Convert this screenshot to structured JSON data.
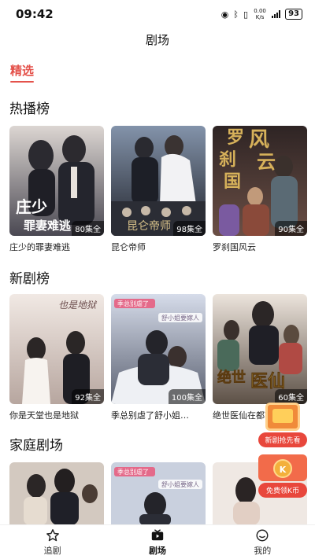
{
  "status_bar": {
    "time": "09:42",
    "network_speed": "0.00 K/s",
    "battery": "93"
  },
  "header": {
    "title": "剧场"
  },
  "top_tabs": [
    {
      "label": "精选",
      "active": true
    }
  ],
  "sections": [
    {
      "title": "热播榜",
      "items": [
        {
          "title": "庄少的罪妻难逃",
          "episodes": "80集全",
          "poster_text": "庄少的罪妻难逃",
          "colors": [
            "#d9d3cf",
            "#3b3a44"
          ]
        },
        {
          "title": "昆仑帝师",
          "episodes": "98集全",
          "poster_text": "",
          "colors": [
            "#7f8fa6",
            "#2a2c36"
          ]
        },
        {
          "title": "罗刹国风云",
          "episodes": "90集全",
          "poster_text": "罗刹国风云",
          "colors": [
            "#b8a690",
            "#3d2d2b"
          ]
        }
      ]
    },
    {
      "title": "新剧榜",
      "items": [
        {
          "title": "你是天堂也是地狱",
          "episodes": "92集全",
          "poster_text": "也是地狱",
          "colors": [
            "#efe6e2",
            "#b9a8a2"
          ]
        },
        {
          "title": "季总别虐了舒小姐…",
          "episodes": "100集全",
          "poster_text": "季总别虐了",
          "colors": [
            "#cfd6e4",
            "#5b6170"
          ]
        },
        {
          "title": "绝世医仙在都市",
          "episodes": "60集全",
          "poster_text": "绝世医仙",
          "colors": [
            "#e7ddd6",
            "#5a4e44"
          ]
        }
      ]
    },
    {
      "title": "家庭剧场",
      "items": [
        {
          "title": "",
          "episodes": "",
          "poster_text": "",
          "colors": [
            "#d8cfc7",
            "#6b5e55"
          ]
        },
        {
          "title": "",
          "episodes": "",
          "poster_text": "季总别虐了",
          "colors": [
            "#cfd6e4",
            "#4f5564"
          ]
        },
        {
          "title": "",
          "episodes": "",
          "poster_text": "",
          "colors": [
            "#f2ece8",
            "#cdb9ad"
          ]
        }
      ]
    }
  ],
  "floating_promos": [
    {
      "label": "新剧抢先看",
      "icon": "tv-icon"
    },
    {
      "label": "免费领K币",
      "icon": "coin-icon",
      "coin_letter": "K"
    }
  ],
  "bottom_nav": [
    {
      "label": "追剧",
      "icon": "star-icon",
      "active": false
    },
    {
      "label": "剧场",
      "icon": "play-tv-icon",
      "active": true
    },
    {
      "label": "我的",
      "icon": "profile-icon",
      "active": false
    }
  ],
  "accent_color": "#e4524b"
}
